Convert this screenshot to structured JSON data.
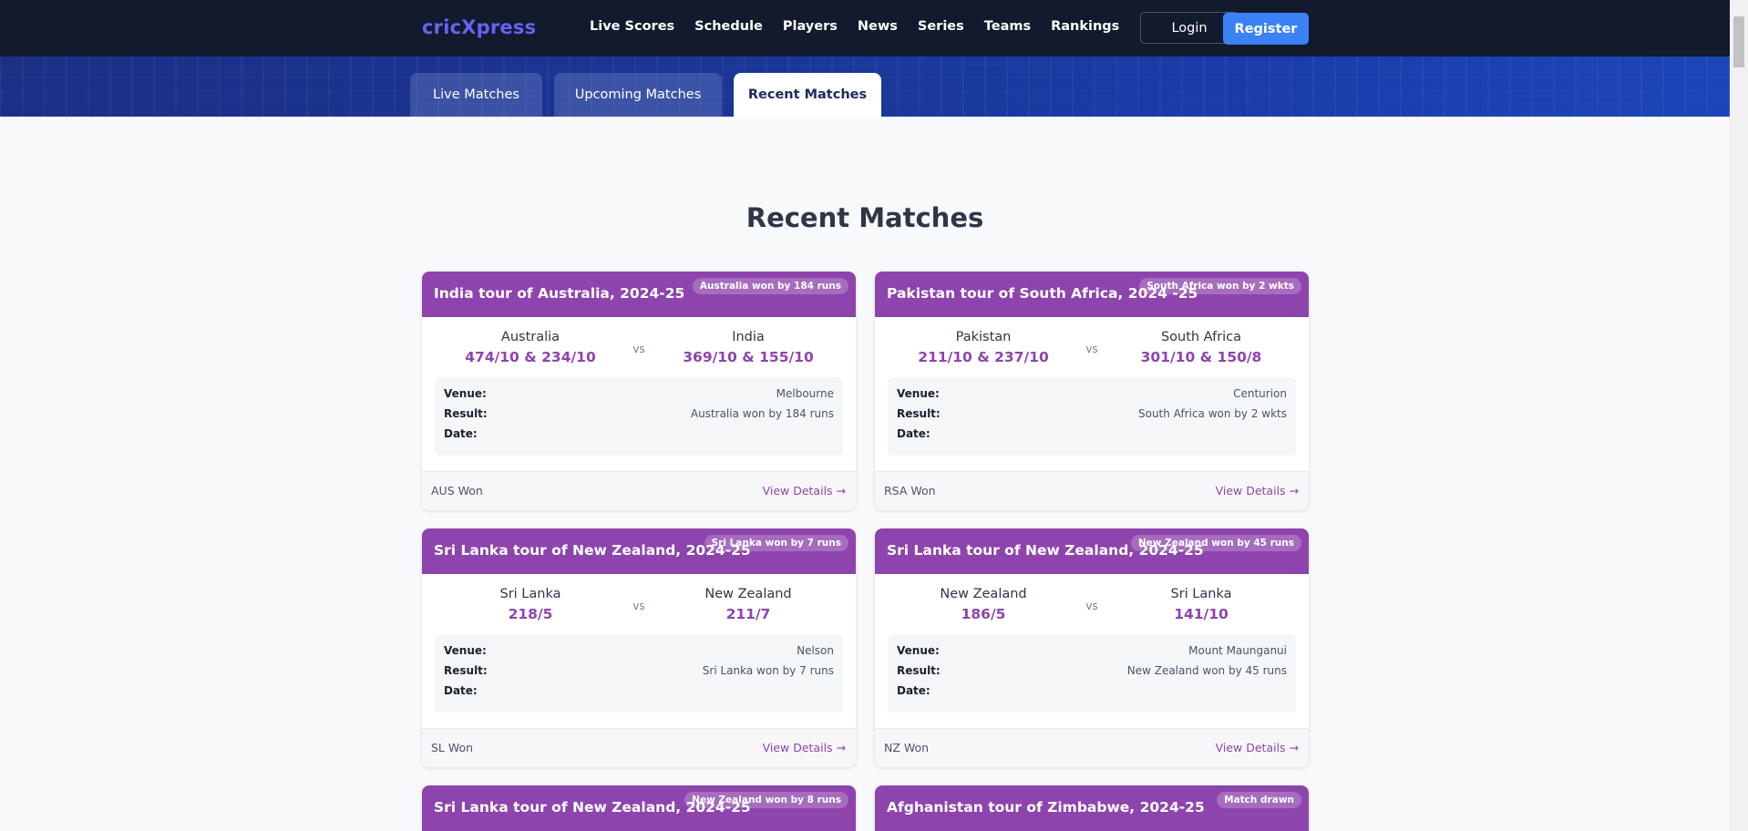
{
  "brand": {
    "logo": "cricXpress"
  },
  "nav": {
    "links": [
      "Live Scores",
      "Schedule",
      "Players",
      "News",
      "Series",
      "Teams",
      "Rankings"
    ],
    "login": "Login",
    "register": "Register"
  },
  "tabs": [
    "Live Matches",
    "Upcoming Matches",
    "Recent Matches"
  ],
  "section_title": "Recent Matches",
  "labels": {
    "venue": "Venue:",
    "result": "Result:",
    "date": "Date:",
    "vs": "vs",
    "view_details": "View Details →"
  },
  "matches": [
    {
      "series": "India tour of Australia, 2024-25",
      "badge": "Australia won by 184 runs",
      "team1": {
        "name": "Australia",
        "score": "474/10 & 234/10"
      },
      "team2": {
        "name": "India",
        "score": "369/10 & 155/10"
      },
      "venue": "Melbourne",
      "result": "Australia won by 184 runs",
      "date": "",
      "winner": "AUS Won"
    },
    {
      "series": "Pakistan tour of South Africa, 2024 -25",
      "badge": "South Africa won by 2 wkts",
      "team1": {
        "name": "Pakistan",
        "score": "211/10 & 237/10"
      },
      "team2": {
        "name": "South Africa",
        "score": "301/10 & 150/8"
      },
      "venue": "Centurion",
      "result": "South Africa won by 2 wkts",
      "date": "",
      "winner": "RSA Won"
    },
    {
      "series": "Sri Lanka tour of New Zealand, 2024-25",
      "badge": "Sri Lanka won by 7 runs",
      "team1": {
        "name": "Sri Lanka",
        "score": "218/5"
      },
      "team2": {
        "name": "New Zealand",
        "score": "211/7"
      },
      "venue": "Nelson",
      "result": "Sri Lanka won by 7 runs",
      "date": "",
      "winner": "SL Won"
    },
    {
      "series": "Sri Lanka tour of New Zealand, 2024-25",
      "badge": "New Zealand won by 45 runs",
      "team1": {
        "name": "New Zealand",
        "score": "186/5"
      },
      "team2": {
        "name": "Sri Lanka",
        "score": "141/10"
      },
      "venue": "Mount Maunganui",
      "result": "New Zealand won by 45 runs",
      "date": "",
      "winner": "NZ Won"
    },
    {
      "series": "Sri Lanka tour of New Zealand, 2024-25",
      "badge": "New Zealand won by 8 runs"
    },
    {
      "series": "Afghanistan tour of Zimbabwe, 2024-25",
      "badge": "Match drawn"
    }
  ]
}
